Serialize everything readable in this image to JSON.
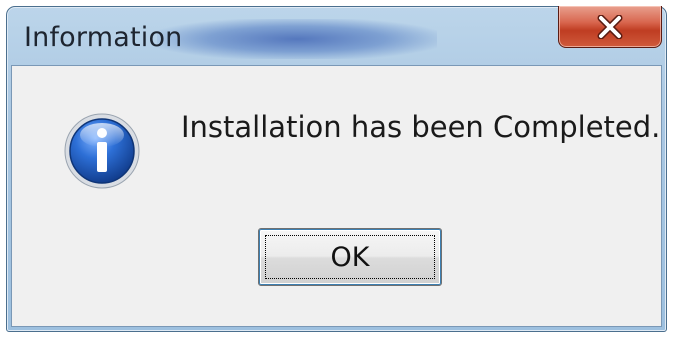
{
  "window": {
    "title": "Information"
  },
  "titlebar": {
    "close_icon": "close-x-icon"
  },
  "dialog": {
    "icon": "information-icon",
    "message": "Installation has been Completed.",
    "ok_label": "OK"
  },
  "colors": {
    "titlebar": "#a9c7e2",
    "close_button": "#c94a2e",
    "client_background": "#f0f0f0",
    "info_icon_blue": "#1f5fbf"
  }
}
